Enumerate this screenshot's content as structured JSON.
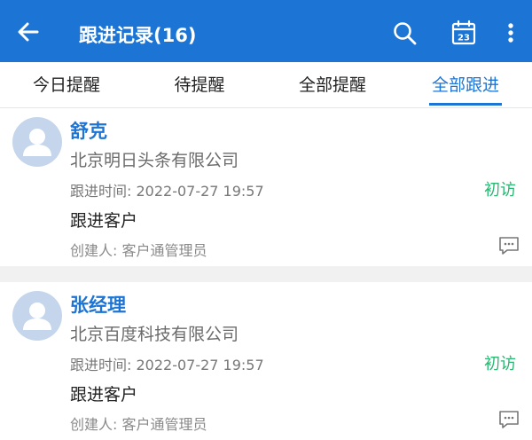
{
  "header": {
    "title": "跟进记录(16)",
    "icons": [
      "back-arrow-icon",
      "search-icon",
      "calendar-icon",
      "more-vertical-icon"
    ],
    "calendar_day": "23",
    "color": "#1c74d4"
  },
  "tabs": [
    {
      "label": "今日提醒"
    },
    {
      "label": "待提醒"
    },
    {
      "label": "全部提醒"
    },
    {
      "label": "全部跟进",
      "active": true
    }
  ],
  "records": [
    {
      "name": "舒克",
      "company": "北京明日头条有限公司",
      "time": "跟进时间: 2022-07-27 19:57",
      "tag": "初访",
      "content": "跟进客户",
      "creator": "创建人: 客户通管理员"
    },
    {
      "name": "张经理",
      "company": "北京百度科技有限公司",
      "time": "跟进时间: 2022-07-27 19:57",
      "tag": "初访",
      "content": "跟进客户",
      "creator": "创建人: 客户通管理员"
    }
  ],
  "colors": {
    "accent": "#1c74d4",
    "tag": "#2bb673"
  }
}
